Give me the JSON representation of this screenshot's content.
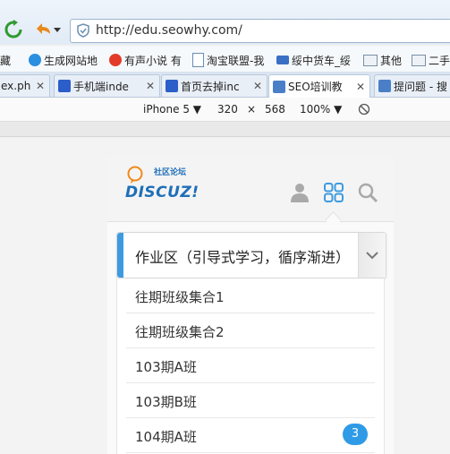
{
  "browser": {
    "address": {
      "url": "http://edu.seowhy.com/"
    },
    "bookmarks": [
      {
        "label": "收藏",
        "icon": "folder-icon"
      },
      {
        "label": "生成网站地",
        "icon": "globe-icon"
      },
      {
        "label": "有声小说 有",
        "icon": "audio-icon"
      },
      {
        "label": "淘宝联盟-我",
        "icon": "page-icon"
      },
      {
        "label": "绥中货车_绥",
        "icon": "truck-icon"
      },
      {
        "label": "其他",
        "icon": "folder-icon"
      },
      {
        "label": "二手",
        "icon": "folder-icon"
      }
    ],
    "tabs": [
      {
        "label": "ex.ph",
        "icon": "page-icon",
        "active": false
      },
      {
        "label": "手机端inde",
        "icon": "paw-icon",
        "active": false
      },
      {
        "label": "首页去掉inc",
        "icon": "paw-icon",
        "active": false
      },
      {
        "label": "SEO培训教",
        "icon": "s-icon",
        "active": true
      },
      {
        "label": "提问题 - 搜",
        "icon": "s-icon",
        "active": false
      }
    ],
    "tab_close": "✕",
    "device_toolbar": {
      "device": "iPhone 5 ▼",
      "width": "320",
      "times": "×",
      "height": "568",
      "zoom": "100% ▼"
    }
  },
  "site": {
    "logo_sub": "社区论坛",
    "logo_word": "DISCUZ!",
    "forum_select": {
      "label": "作业区（引导式学习，循序渐进）"
    },
    "forums": [
      {
        "name": "往期班级集合1",
        "badge": ""
      },
      {
        "name": "往期班级集合2",
        "badge": ""
      },
      {
        "name": "103期A班",
        "badge": ""
      },
      {
        "name": "103期B班",
        "badge": ""
      },
      {
        "name": "104期A班",
        "badge": "3"
      }
    ]
  },
  "colors": {
    "accent": "#3c9be0",
    "brand": "#1e6fb8",
    "badge": "#2f9ae6"
  }
}
